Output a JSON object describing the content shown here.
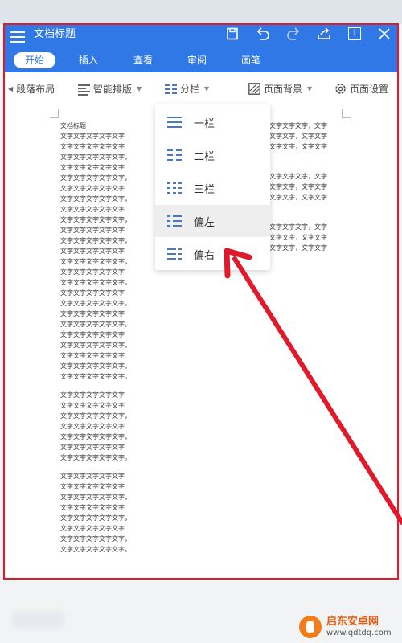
{
  "app": {
    "title": "文档标题",
    "page_indicator": "1"
  },
  "toolbar_icons": [
    "save-icon",
    "undo-icon",
    "redo-icon",
    "share-icon",
    "page-count-icon",
    "close-icon"
  ],
  "tabs": [
    {
      "label": "开始",
      "active": true
    },
    {
      "label": "插入",
      "active": false
    },
    {
      "label": "查看",
      "active": false
    },
    {
      "label": "审阅",
      "active": false
    },
    {
      "label": "画笔",
      "active": false
    }
  ],
  "ribbon": {
    "paragraph_layout": "段落布局",
    "smart_layout": "智能排版",
    "columns": "分栏",
    "page_background": "页面背景",
    "page_setup": "页面设置"
  },
  "columns_menu": {
    "items": [
      {
        "label": "一栏",
        "highlighted": false
      },
      {
        "label": "二栏",
        "highlighted": false
      },
      {
        "label": "三栏",
        "highlighted": false
      },
      {
        "label": "偏左",
        "highlighted": true
      },
      {
        "label": "偏右",
        "highlighted": false
      }
    ]
  },
  "document": {
    "left_col_title": "文档标题",
    "left_paragraphs": [
      "文字文字文字文字文字\n文字文字文字文字文字\n文字文字文字文字文字，\n文字文字文字文字文字\n文字文字文字文字文字，\n文字文字文字文字文字\n文字文字文字文字文字，\n文字文字文字文字文字\n文字文字文字文字文字，\n文字文字文字文字文字\n文字文字文字文字文字，\n文字文字文字文字文字\n文字文字文字文字文字，\n文字文字文字文字文字\n文字文字文字文字文字，\n文字文字文字文字文字\n文字文字文字文字文字，\n文字文字文字文字文字\n文字文字文字文字文字，\n文字文字文字文字文字\n文字文字文字文字文字，\n文字文字文字文字文字\n文字文字文字文字文字，\n文字文字文字文字文字。",
      "文字文字文字文字文字\n文字文字文字文字文字\n文字文字文字文字文字，\n文字文字文字文字文字\n文字文字文字文字文字，\n文字文字文字文字文字\n文字文字文字文字文字。",
      "文字文字文字文字文字\n文字文字文字文字文字\n文字文字文字文字文字，\n文字文字文字文字文字\n文字文字文字文字文字，\n文字文字文字文字文字\n文字文字文字文字文字，\n文字文字文字文字文字。"
    ],
    "right_paragraphs": [
      "文字文字文字，文字\n文字文字，文字文字\n文字文字，文字文字",
      "文字文字文字，文字\n文字文字，文字文字\n文字文字，文字文字",
      "文字文字文字，文字\n文字文字，文字文字\n文字文字，文字文字"
    ]
  },
  "watermark": {
    "name": "启东安卓网",
    "url": "www.qdtdq.com"
  },
  "colors": {
    "accent": "#2f78e6",
    "annotation": "#e0192b"
  }
}
